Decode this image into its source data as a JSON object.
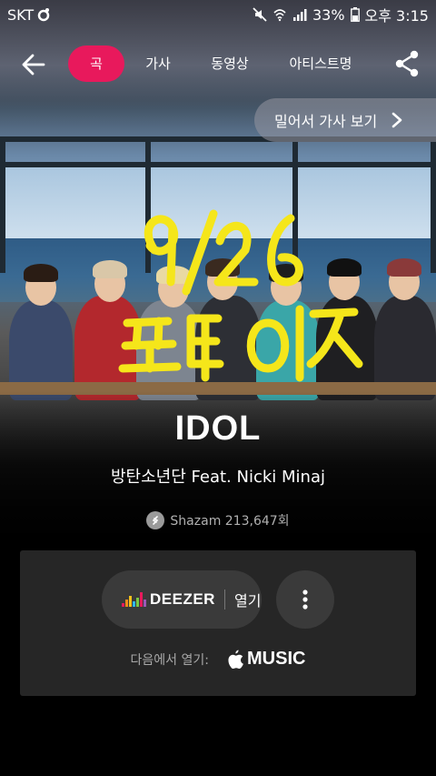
{
  "status_bar": {
    "carrier": "SKT",
    "battery": "33%",
    "time": "오후 3:15",
    "icons": [
      "mute-icon",
      "wifi-icon",
      "signal-icon",
      "battery-icon"
    ]
  },
  "nav": {
    "tabs": [
      {
        "label": "곡",
        "active": true
      },
      {
        "label": "가사",
        "active": false
      },
      {
        "label": "동영상",
        "active": false
      },
      {
        "label": "아티스트명",
        "active": false
      }
    ],
    "back_icon": "arrow-left-icon",
    "share_icon": "share-icon"
  },
  "swipe_hint": {
    "label": "밀어서 가사 보기"
  },
  "overlay_scribble": {
    "line1": "9/26",
    "line2": "프텐이즈",
    "color": "#f5e61a"
  },
  "song": {
    "title": "IDOL",
    "artist": "방탄소년단 Feat. Nicki Minaj",
    "shazam_count": "Shazam 213,647회"
  },
  "player_card": {
    "deezer_label": "DEEZER",
    "deezer_action": "열기",
    "more_icon": "more-vertical-icon",
    "open_in_label": "다음에서 열기:",
    "apple_music_label": "MUSIC"
  },
  "colors": {
    "accent": "#e8195c",
    "background": "#000000",
    "card": "#262626"
  }
}
